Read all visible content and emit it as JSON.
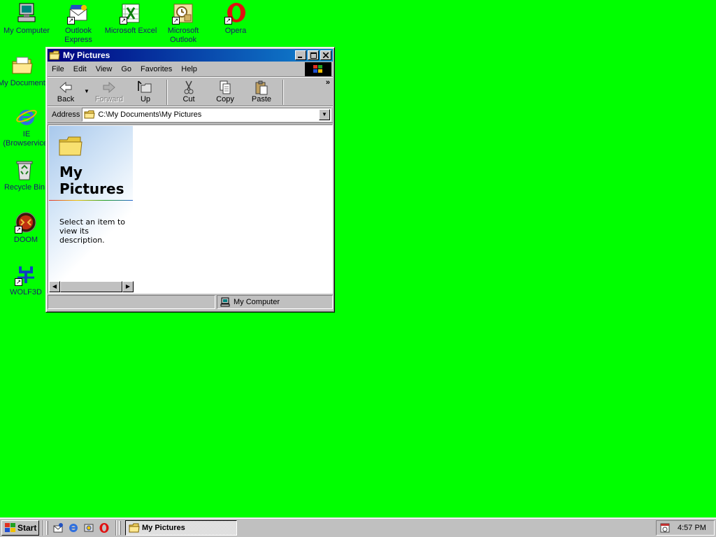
{
  "desktop": {
    "icons": [
      {
        "label": "My Computer",
        "icon": "my-computer-icon"
      },
      {
        "label": "Outlook Express",
        "icon": "outlook-express-icon"
      },
      {
        "label": "Microsoft Excel",
        "icon": "excel-icon"
      },
      {
        "label": "Microsoft Outlook",
        "icon": "outlook-icon"
      },
      {
        "label": "Opera",
        "icon": "opera-icon"
      },
      {
        "label": "My Documents",
        "icon": "my-documents-icon"
      },
      {
        "label": "IE (Browservice)",
        "icon": "internet-explorer-icon"
      },
      {
        "label": "Recycle Bin",
        "icon": "recycle-bin-icon"
      },
      {
        "label": "DOOM",
        "icon": "doom-icon"
      },
      {
        "label": "WOLF3D",
        "icon": "wolf3d-icon"
      }
    ]
  },
  "window": {
    "title": "My Pictures",
    "menu": [
      "File",
      "Edit",
      "View",
      "Go",
      "Favorites",
      "Help"
    ],
    "toolbar": {
      "back": "Back",
      "forward": "Forward",
      "up": "Up",
      "cut": "Cut",
      "copy": "Copy",
      "paste": "Paste",
      "more": "»"
    },
    "address": {
      "label": "Address",
      "value": "C:\\My Documents\\My Pictures"
    },
    "sidepanel": {
      "title": "My Pictures",
      "description": "Select an item to view its description."
    },
    "status": {
      "left": "",
      "right": "My Computer"
    }
  },
  "taskbar": {
    "start_label": "Start",
    "quicklaunch": [
      "outlook-express-icon",
      "internet-explorer-icon",
      "channels-icon",
      "opera-icon"
    ],
    "tasks": [
      {
        "label": "My Pictures"
      }
    ],
    "clock": "4:57 PM"
  },
  "colors": {
    "desktop": "#00ff00",
    "titlebar": "#000080",
    "face": "#c0c0c0"
  }
}
